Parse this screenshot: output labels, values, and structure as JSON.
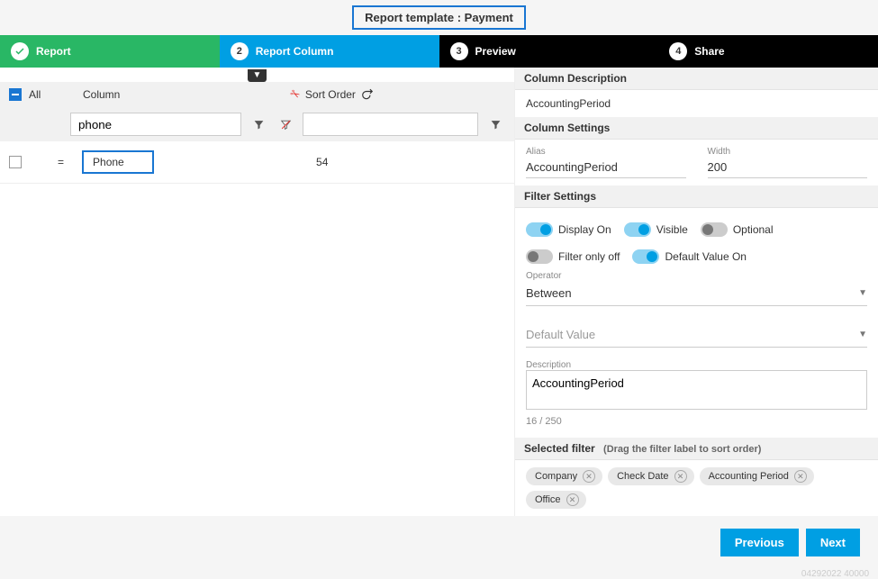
{
  "template_title": "Report template : Payment",
  "steps": [
    "Report",
    "Report Column",
    "Preview",
    "Share"
  ],
  "left": {
    "all_label": "All",
    "column_label": "Column",
    "sort_label": "Sort Order",
    "filter_value": "phone",
    "row": {
      "eq": "=",
      "col": "Phone",
      "val": "54"
    }
  },
  "right": {
    "col_desc_header": "Column Description",
    "col_desc_value": "AccountingPeriod",
    "col_settings_header": "Column Settings",
    "alias_label": "Alias",
    "alias_value": "AccountingPeriod",
    "width_label": "Width",
    "width_value": "200",
    "filter_settings_header": "Filter Settings",
    "toggles": {
      "display": "Display On",
      "visible": "Visible",
      "optional": "Optional",
      "filter_only": "Filter only off",
      "default_value": "Default Value On"
    },
    "operator_label": "Operator",
    "operator_value": "Between",
    "default_value_ph": "Default Value",
    "description_label": "Description",
    "description_value": "AccountingPeriod",
    "char_count": "16 / 250",
    "selected_filter_header": "Selected filter",
    "selected_filter_hint": "(Drag the filter label to sort order)",
    "filter_chips": [
      "Company",
      "Check Date",
      "Accounting Period",
      "Office"
    ]
  },
  "footer": {
    "previous": "Previous",
    "next": "Next"
  },
  "build": "04292022 40000"
}
